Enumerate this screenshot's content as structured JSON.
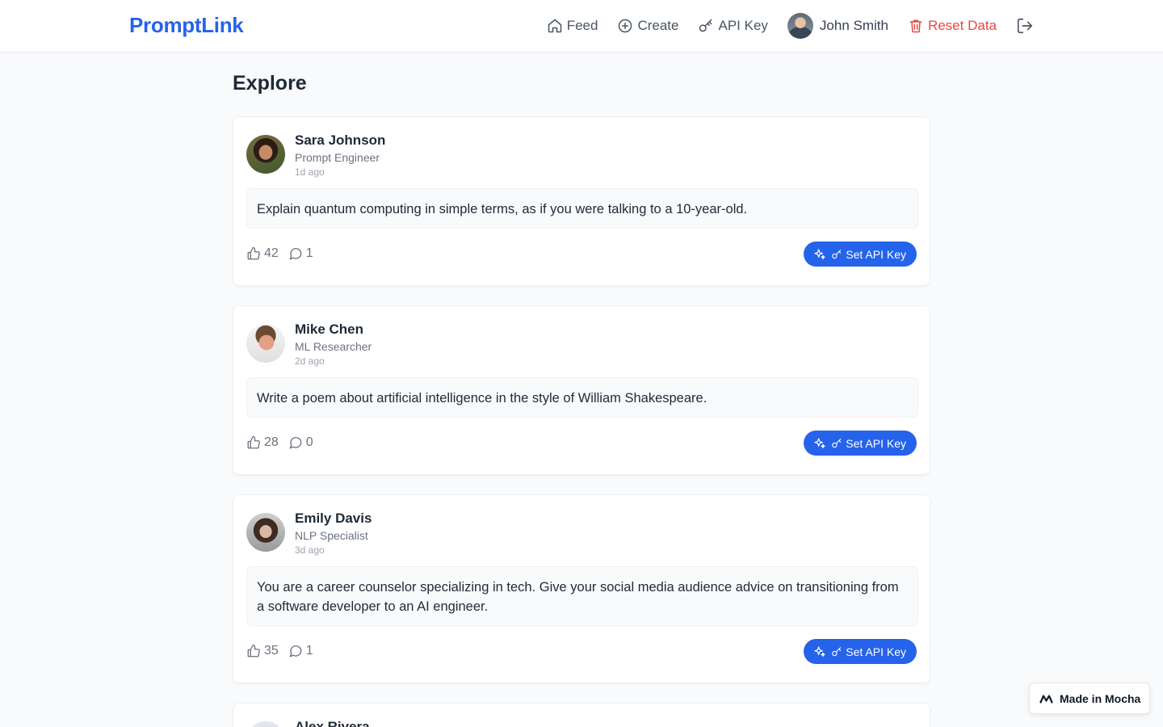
{
  "header": {
    "brand": "PromptLink",
    "nav": {
      "feed": "Feed",
      "create": "Create",
      "api_key": "API Key",
      "user_name": "John Smith",
      "reset": "Reset Data"
    }
  },
  "main": {
    "title": "Explore",
    "posts": [
      {
        "author": "Sara Johnson",
        "role": "Prompt Engineer",
        "time": "1d ago",
        "prompt": "Explain quantum computing in simple terms, as if you were talking to a 10-year-old.",
        "likes": "42",
        "comments": "1",
        "action_label": "Set API Key"
      },
      {
        "author": "Mike Chen",
        "role": "ML Researcher",
        "time": "2d ago",
        "prompt": "Write a poem about artificial intelligence in the style of William Shakespeare.",
        "likes": "28",
        "comments": "0",
        "action_label": "Set API Key"
      },
      {
        "author": "Emily Davis",
        "role": "NLP Specialist",
        "time": "3d ago",
        "prompt": "You are a career counselor specializing in tech. Give your social media audience advice on transitioning from a software developer to an AI engineer.",
        "likes": "35",
        "comments": "1",
        "action_label": "Set API Key"
      },
      {
        "author": "Alex Rivera"
      }
    ]
  },
  "badge": {
    "label": "Made in Mocha"
  },
  "colors": {
    "accent": "#2563eb",
    "danger": "#ef4444",
    "background": "#f9fafb"
  },
  "icons": {
    "feed": "home-icon",
    "create": "plus-circle-icon",
    "api_key": "key-icon",
    "reset": "trash-icon",
    "logout": "logout-icon",
    "like": "thumbs-up-icon",
    "comment": "comment-icon",
    "run": "sparkles-icon"
  }
}
